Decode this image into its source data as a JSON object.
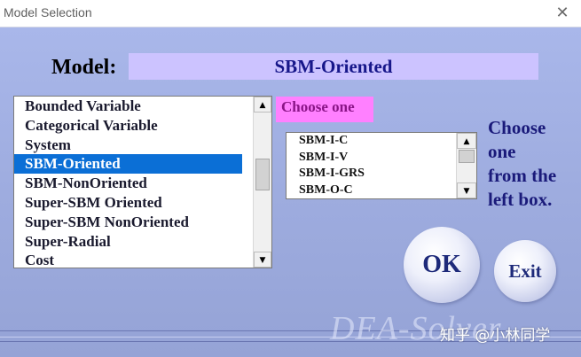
{
  "window": {
    "title": "Model Selection"
  },
  "header": {
    "label": "Model:",
    "value": "SBM-Oriented"
  },
  "left_list": {
    "items": [
      "Bounded Variable",
      "Categorical Variable",
      "System",
      "SBM-Oriented",
      "SBM-NonOriented",
      "Super-SBM Oriented",
      "Super-SBM NonOriented",
      "Super-Radial",
      "Cost"
    ],
    "selected": "SBM-Oriented"
  },
  "choose_label": "Choose one",
  "right_list": {
    "items": [
      "SBM-I-C",
      "SBM-I-V",
      "SBM-I-GRS",
      "SBM-O-C"
    ]
  },
  "hint": [
    "Choose",
    "one",
    "from the",
    "left box."
  ],
  "buttons": {
    "ok": "OK",
    "exit": "Exit"
  },
  "footer_logo": "DEA-Solver",
  "overlay_watermark": "知乎 @小林同学",
  "colors": {
    "background": "#a3b1e4",
    "selection": "#0b6fd6",
    "model_value_bg": "#ccc3ff",
    "choose_bg": "#ff80ff"
  }
}
